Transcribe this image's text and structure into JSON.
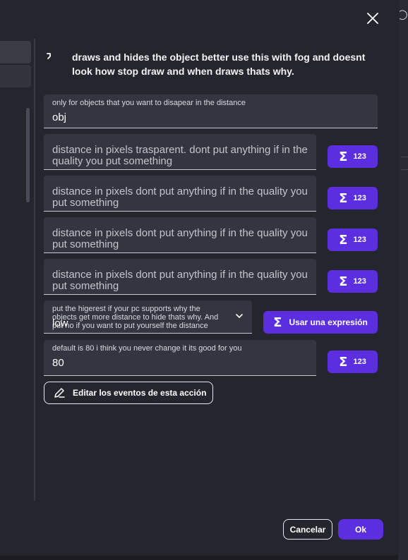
{
  "dialog": {
    "description": "draws and hides the object better use this with fog and doesnt look how stop draw and when draws thats why."
  },
  "fields": {
    "object": {
      "label": "only for objects that you want to disapear in the distance",
      "value": "obj"
    },
    "distance_transparent": {
      "text": "distance in pixels trasparent. dont put anything if in the quality you put something"
    },
    "distance_1": {
      "text": "distance in pixels dont put anything if in the quality you put something"
    },
    "distance_2": {
      "text": "distance in pixels dont put anything if in the quality you put something"
    },
    "distance_3": {
      "text": "distance in pixels dont put anything if in the quality you put something"
    },
    "quality": {
      "label": "put the higerest if your pc supports why the objects get more distance to hide thats why. And put no if you want to put yourself the distance",
      "value": "low"
    },
    "fov": {
      "label": "default is 80 i think you never change it its good for you",
      "value": "80"
    }
  },
  "buttons": {
    "number_label": "123",
    "expression_label": "Usar una expresión",
    "edit_events_label": "Editar los eventos de esta acción",
    "cancel_label": "Cancelar",
    "ok_label": "Ok"
  },
  "icons": {
    "close": "close-icon",
    "sigma": "sigma-icon",
    "chevron": "chevron-down-icon",
    "pencil": "pencil-icon"
  },
  "colors": {
    "accent": "#5b2fe0",
    "dialog_bg": "#25252e",
    "field_bg": "#353541"
  }
}
